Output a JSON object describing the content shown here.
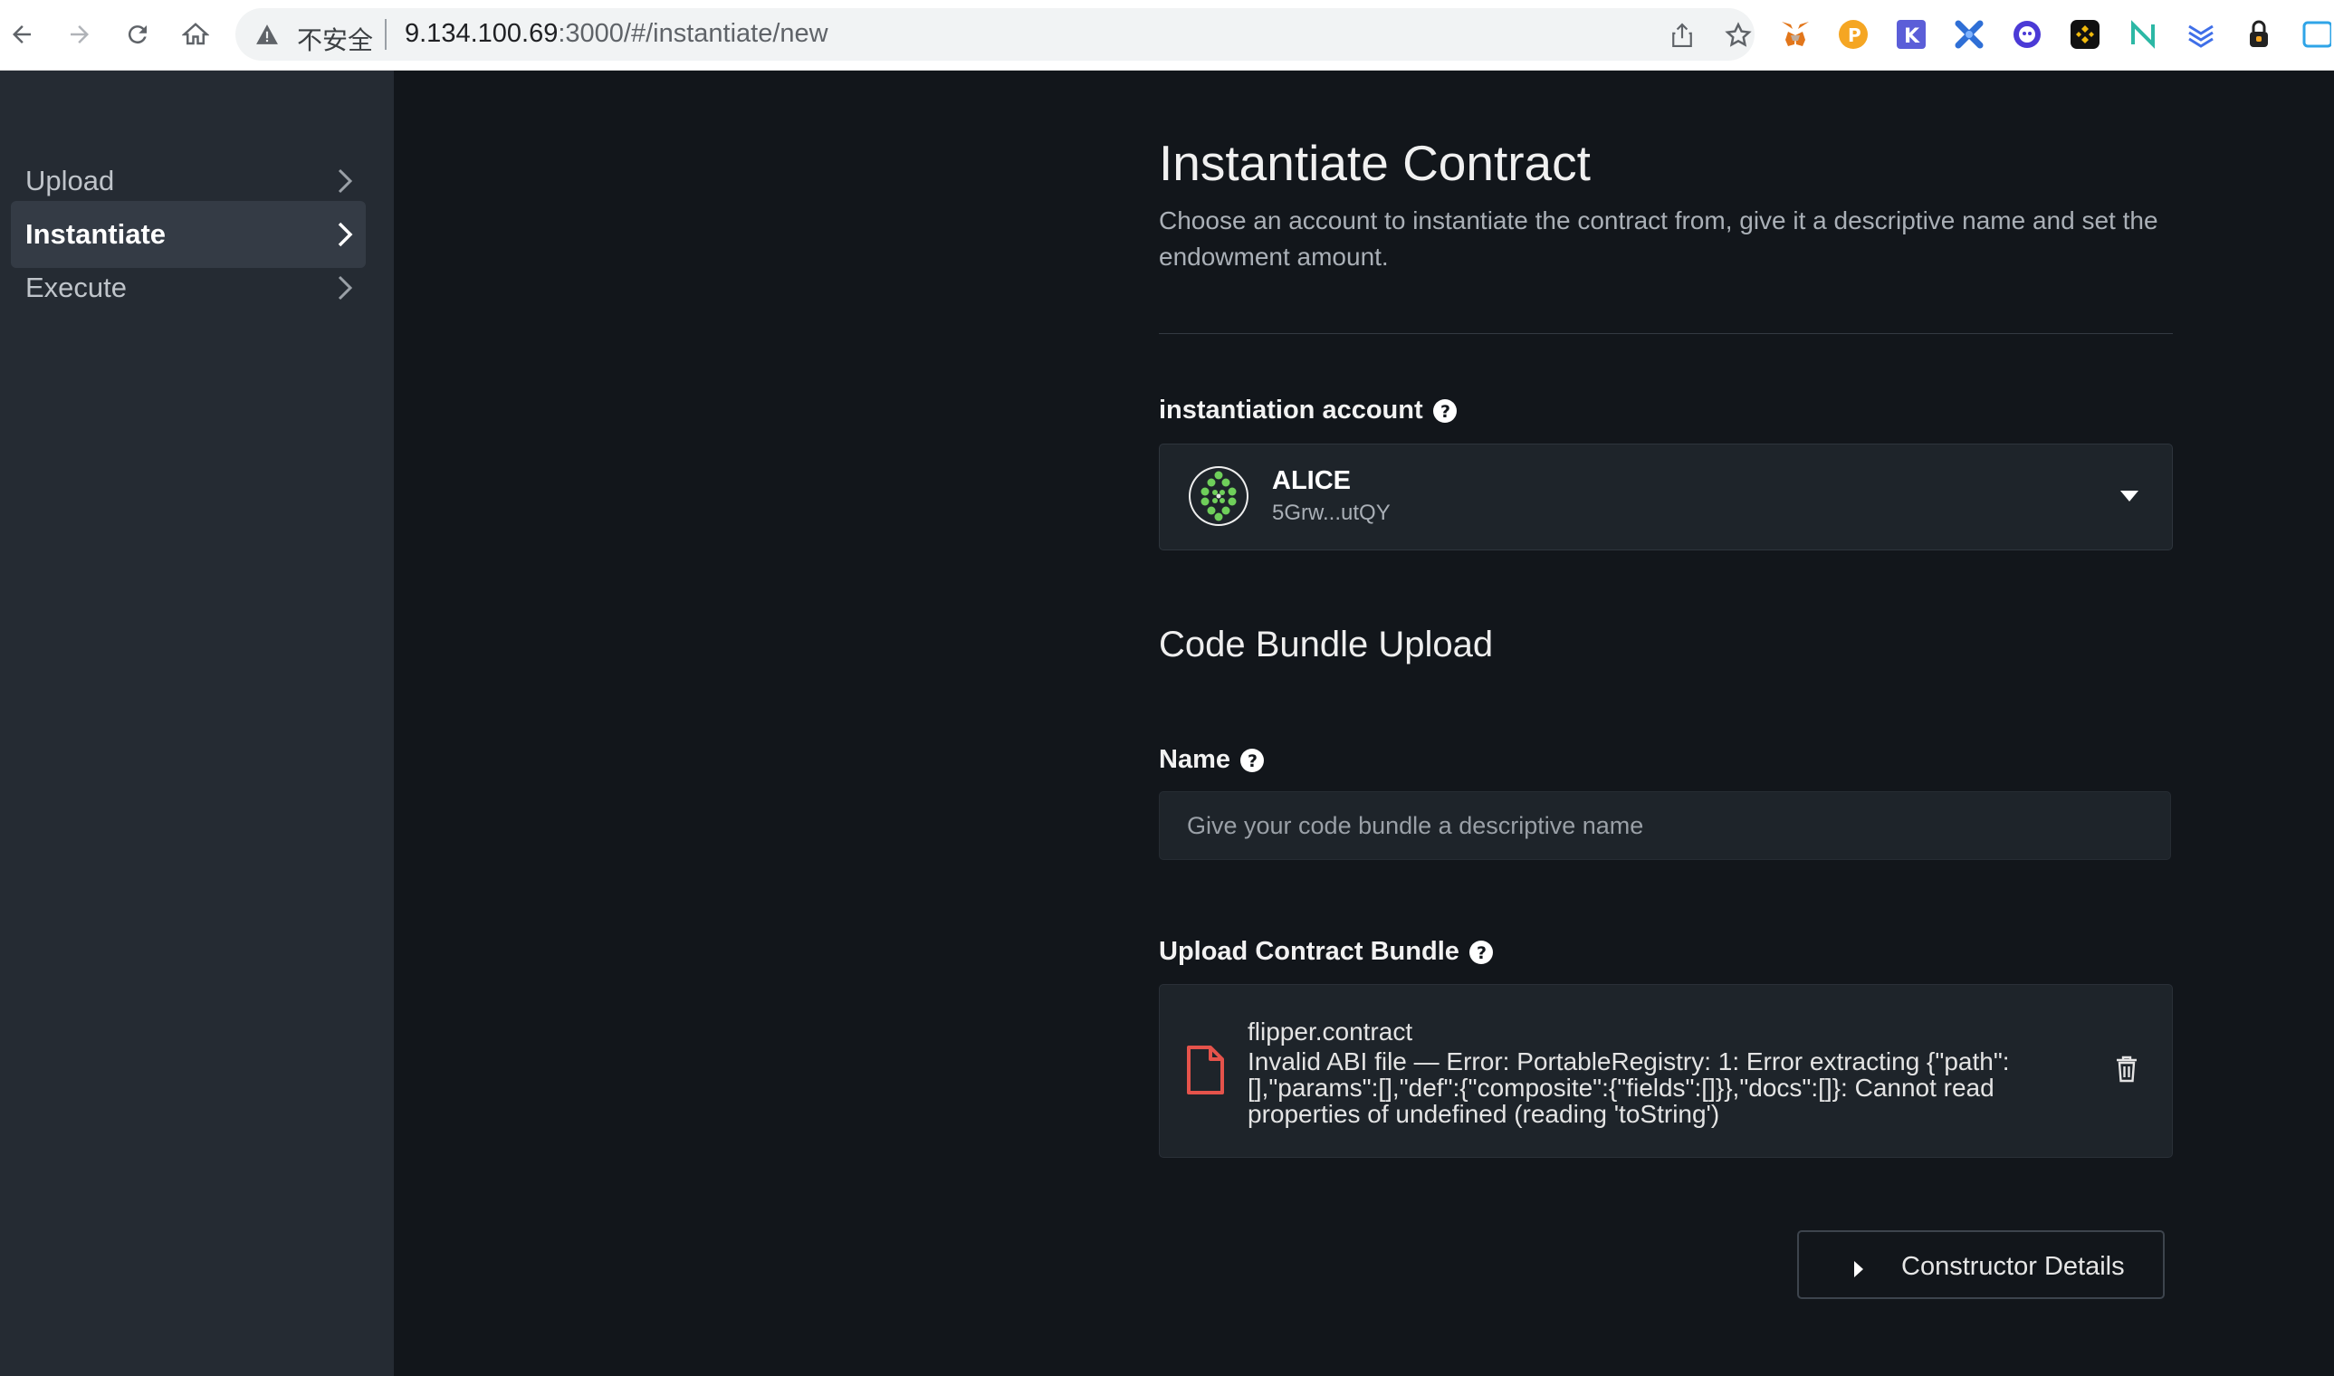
{
  "browser": {
    "security_label": "不安全",
    "url_host": "9.134.100.69",
    "url_rest": ":3000/#/instantiate/new"
  },
  "sidebar": {
    "items": [
      {
        "label": "Upload"
      },
      {
        "label": "Instantiate"
      },
      {
        "label": "Execute"
      }
    ]
  },
  "page": {
    "title": "Instantiate Contract",
    "description": "Choose an account to instantiate the contract from, give it a descriptive name and set the endowment amount."
  },
  "account": {
    "label": "instantiation account",
    "name": "ALICE",
    "address": "5Grw...utQY"
  },
  "bundle": {
    "section_title": "Code Bundle Upload",
    "name_label": "Name",
    "name_placeholder": "Give your code bundle a descriptive name",
    "upload_label": "Upload Contract Bundle",
    "file_name": "flipper.contract",
    "file_error": "Invalid ABI file — Error: PortableRegistry: 1: Error extracting {\"path\":[],\"params\":[],\"def\":{\"composite\":{\"fields\":[]}},\"docs\":[]}: Cannot read properties of undefined (reading 'toString')"
  },
  "constructor_button": "Constructor Details",
  "colors": {
    "accent_green": "#6fcf5a",
    "error_red": "#e5534b",
    "sidebar_bg": "#252b33",
    "page_bg": "#12161b"
  }
}
